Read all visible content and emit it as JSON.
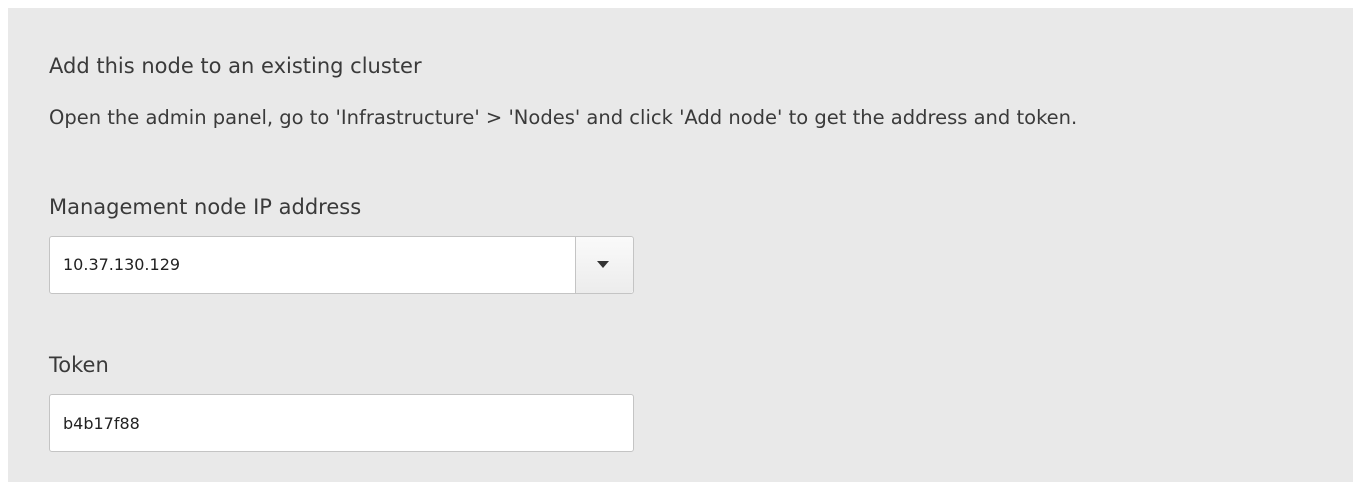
{
  "section": {
    "title": "Add this node to an existing cluster",
    "instructions": "Open the admin panel, go to 'Infrastructure' > 'Nodes' and click 'Add node' to get the address and token."
  },
  "management_ip": {
    "label": "Management node IP address",
    "selected_value": "10.37.130.129",
    "toggle_icon": "chevron-down-icon"
  },
  "token": {
    "label": "Token",
    "value": "b4b17f88"
  }
}
